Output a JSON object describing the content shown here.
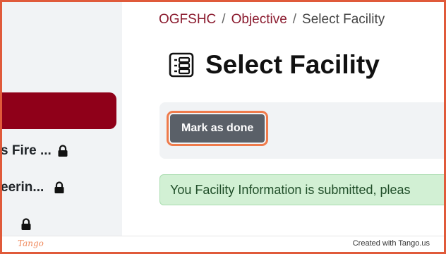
{
  "breadcrumb": {
    "items": [
      "OGFSHC",
      "Objective"
    ],
    "separator": "/",
    "current": "Select Facility"
  },
  "page": {
    "title": "Select Facility"
  },
  "sidebar": {
    "items": [
      {
        "label": "s Fire ...",
        "icon": "lock-icon"
      },
      {
        "label": "eerin...",
        "icon": "lock-icon"
      },
      {
        "label": "",
        "icon": "lock-icon"
      }
    ]
  },
  "actions": {
    "mark_done_label": "Mark as done"
  },
  "alert": {
    "message": "You Facility Information is submitted, pleas"
  },
  "footer": {
    "logo": "Tango",
    "credit": "Created with Tango.us"
  },
  "colors": {
    "brand": "#8f0019",
    "highlight": "#ef7b4b",
    "alert_bg": "#d2f0d4",
    "button_bg": "#5a6068"
  }
}
